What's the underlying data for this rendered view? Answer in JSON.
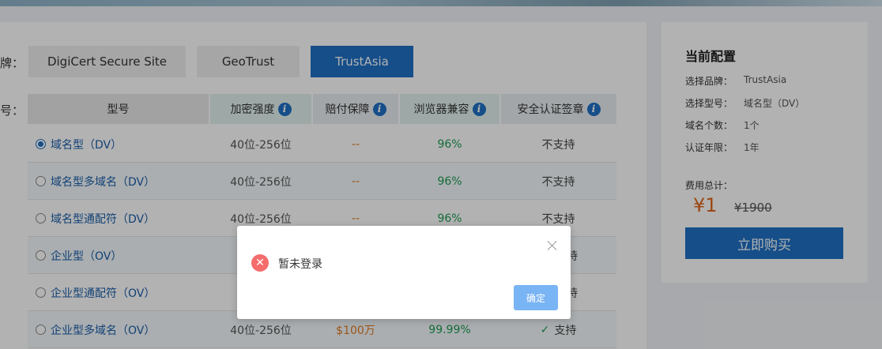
{
  "filters": {
    "brand_label": "牌：",
    "model_label": "号：",
    "brands": [
      "DigiCert Secure Site",
      "GeoTrust",
      "TrustAsia"
    ],
    "active_brand": "TrustAsia"
  },
  "table": {
    "headers": [
      "型号",
      "加密强度",
      "赔付保障",
      "浏览器兼容",
      "安全认证签章"
    ],
    "rows": [
      {
        "name": "域名型（DV）",
        "enc": "40位-256位",
        "ins": "--",
        "brw": "96%",
        "seal": "不支持",
        "selected": true
      },
      {
        "name": "域名型多域名（DV）",
        "enc": "40位-256位",
        "ins": "--",
        "brw": "96%",
        "seal": "不支持",
        "selected": false
      },
      {
        "name": "域名型通配符（DV）",
        "enc": "40位-256位",
        "ins": "--",
        "brw": "96%",
        "seal": "不支持",
        "selected": false
      },
      {
        "name": "企业型（OV）",
        "enc": "4",
        "ins": "",
        "brw": "",
        "seal": "持",
        "selected": false
      },
      {
        "name": "企业型通配符（OV）",
        "enc": "4",
        "ins": "",
        "brw": "",
        "seal": "持",
        "selected": false
      },
      {
        "name": "企业型多域名（OV）",
        "enc": "40位-256位",
        "ins": "$100万",
        "brw": "99.99%",
        "seal": "支持",
        "selected": false
      }
    ]
  },
  "summary": {
    "title": "当前配置",
    "items": [
      {
        "label": "选择品牌：",
        "value": "TrustAsia"
      },
      {
        "label": "选择型号：",
        "value": "域名型（DV）"
      },
      {
        "label": "域名个数：",
        "value": "1个"
      },
      {
        "label": "认证年限：",
        "value": "1年"
      }
    ],
    "total_label": "费用总计：",
    "price": "¥1",
    "original_price": "¥1900",
    "buy_label": "立即购买"
  },
  "dialog": {
    "message": "暂未登录",
    "ok_label": "确定"
  }
}
